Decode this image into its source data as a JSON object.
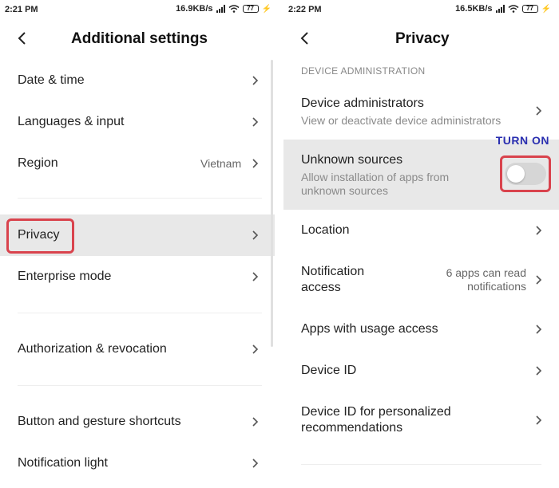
{
  "left": {
    "status": {
      "time": "2:21 PM",
      "speed": "16.9KB/s",
      "battery": "77"
    },
    "title": "Additional settings",
    "items": [
      {
        "label": "Date & time"
      },
      {
        "label": "Languages & input"
      },
      {
        "label": "Region",
        "value": "Vietnam"
      },
      {
        "label": "Privacy",
        "highlighted": true
      },
      {
        "label": "Enterprise mode"
      },
      {
        "label": "Authorization & revocation"
      },
      {
        "label": "Button and gesture shortcuts"
      },
      {
        "label": "Notification light"
      }
    ]
  },
  "right": {
    "status": {
      "time": "2:22 PM",
      "speed": "16.5KB/s",
      "battery": "77"
    },
    "title": "Privacy",
    "section": "DEVICE ADMINISTRATION",
    "annotation": "TURN ON",
    "unknown_sources": {
      "label": "Unknown sources",
      "sub1": "Allow installation of apps from",
      "sub2": "unknown sources",
      "enabled": false
    },
    "items": [
      {
        "label": "Device administrators",
        "sub": "View or deactivate device administrators"
      },
      {
        "label": "Location"
      },
      {
        "label1": "Notification",
        "label2": "access",
        "value1": "6 apps can read",
        "value2": "notifications"
      },
      {
        "label": "Apps with usage access"
      },
      {
        "label": "Device ID"
      },
      {
        "label1": "Device ID for personalized",
        "label2": "recommendations"
      }
    ]
  },
  "colors": {
    "accent_red": "#d9434d",
    "annotation_blue": "#2a2fb0",
    "highlight_bg": "#e8e8e8"
  }
}
